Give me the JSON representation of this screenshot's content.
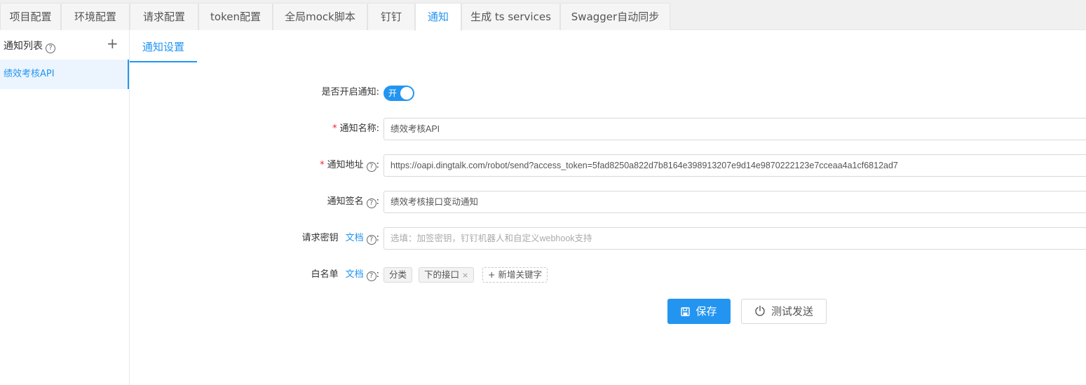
{
  "top_tabs": [
    {
      "label": "项目配置"
    },
    {
      "label": "环境配置"
    },
    {
      "label": "请求配置"
    },
    {
      "label": "token配置"
    },
    {
      "label": "全局mock脚本"
    },
    {
      "label": "钉钉"
    },
    {
      "label": "通知",
      "active": true
    },
    {
      "label": "生成 ts services"
    },
    {
      "label": "Swagger自动同步"
    }
  ],
  "sidebar": {
    "title": "通知列表",
    "help_glyph": "?",
    "add_glyph": "+",
    "items": [
      {
        "label": "绩效考核API",
        "active": true
      }
    ]
  },
  "subtab": {
    "label": "通知设置"
  },
  "form": {
    "enable": {
      "label": "是否开启通知:",
      "switch_text": "开",
      "value": true
    },
    "name": {
      "required_mark": "*",
      "label": "通知名称:",
      "value": "绩效考核API"
    },
    "url": {
      "required_mark": "*",
      "label": "通知地址",
      "value": "https://oapi.dingtalk.com/robot/send?access_token=5fad8250a822d7b8164e398913207e9d14e9870222123e7cceaa4a1cf6812ad7"
    },
    "sign": {
      "label": "通知签名",
      "value": "绩效考核接口变动通知"
    },
    "secret": {
      "label": "请求密钥",
      "doc_link": "文档",
      "placeholder": "选填：加签密钥，钉钉机器人和自定义webhook支持"
    },
    "whitelist": {
      "label": "白名单",
      "doc_link": "文档",
      "tags": [
        "分类",
        "下的接口"
      ],
      "close_glyph": "×",
      "add_label": "+ 新增关键字"
    },
    "colon": ":"
  },
  "buttons": {
    "save": "保存",
    "test": "测试发送"
  },
  "colors": {
    "accent": "#2395f1",
    "required": "#f5222d"
  }
}
